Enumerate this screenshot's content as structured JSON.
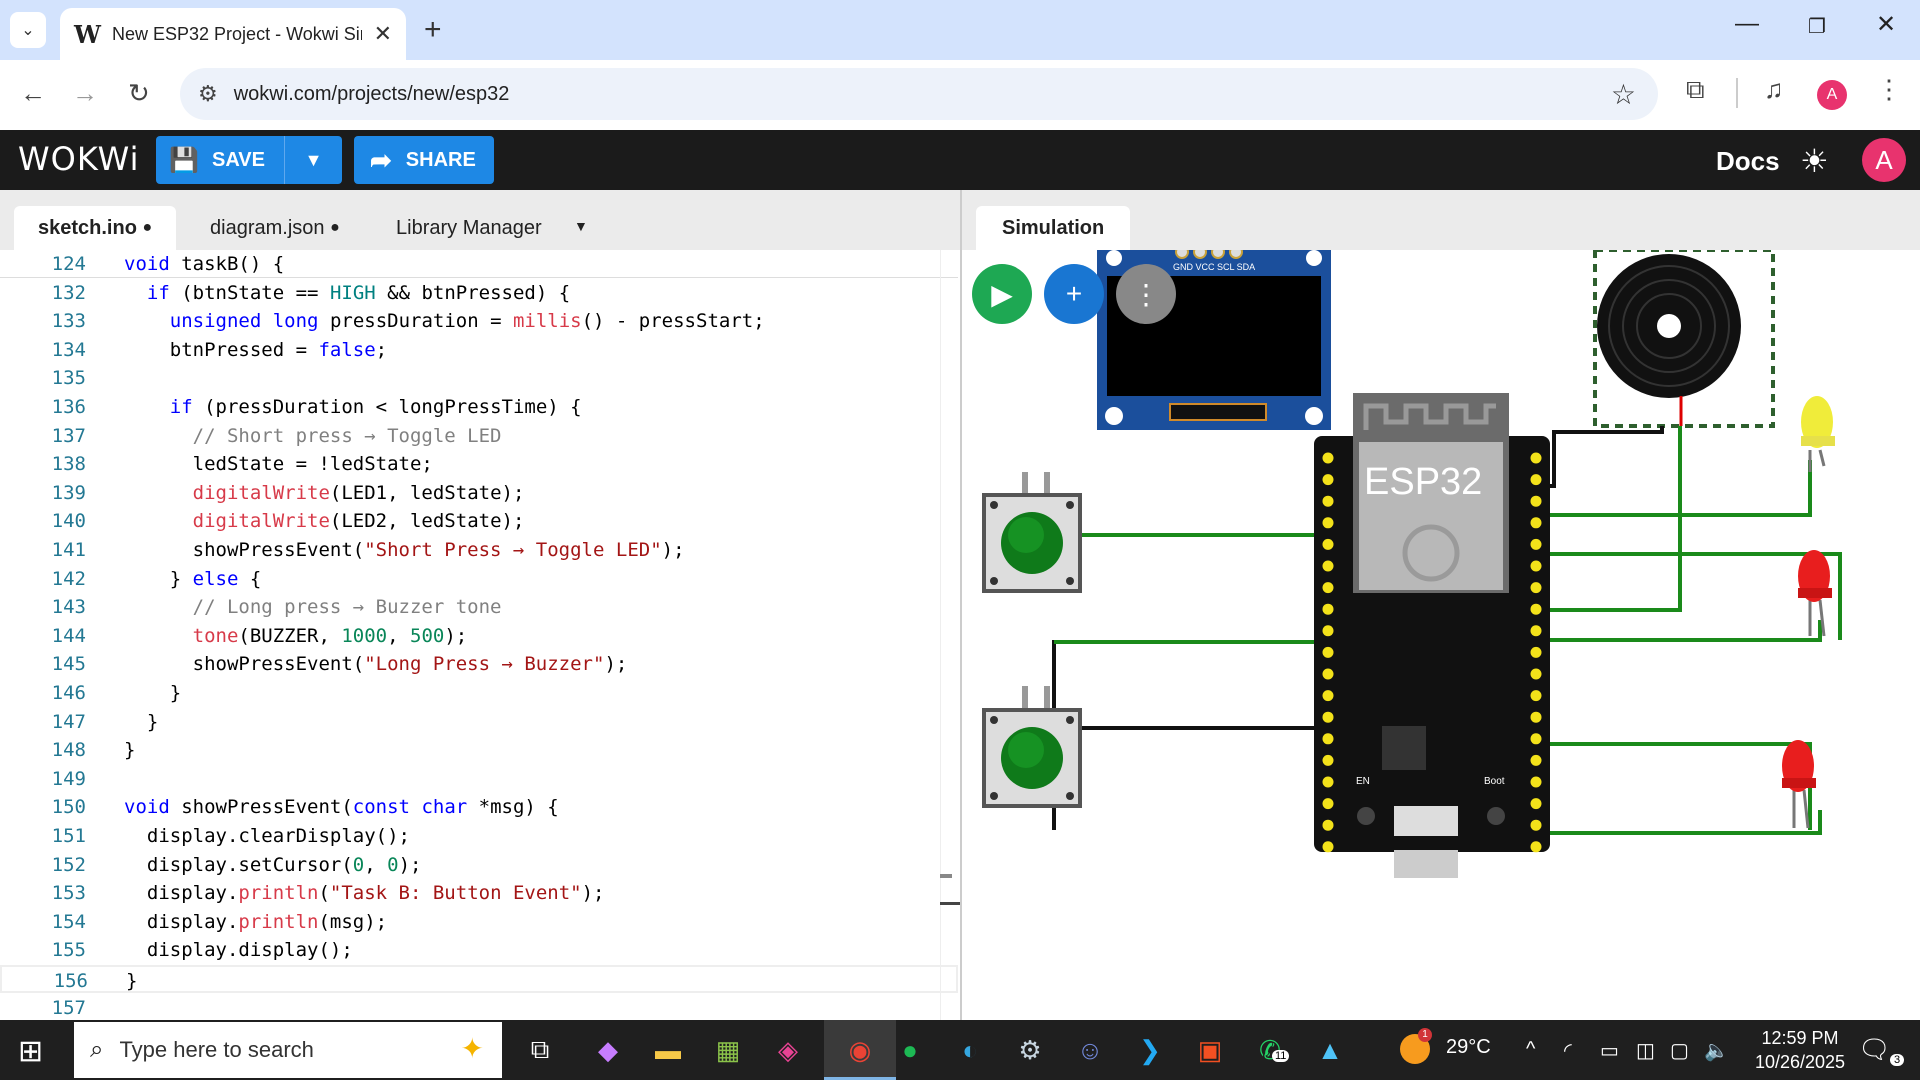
{
  "browser": {
    "tab_title": "New ESP32 Project - Wokwi Sim",
    "url": "wokwi.com/projects/new/esp32",
    "profile_initial": "A"
  },
  "header": {
    "logo": "WOKWi",
    "save_label": "SAVE",
    "share_label": "SHARE",
    "docs_label": "Docs",
    "user_initial": "A"
  },
  "editor": {
    "tabs": [
      {
        "label": "sketch.ino",
        "modified": "●"
      },
      {
        "label": "diagram.json",
        "modified": "●"
      },
      {
        "label": "Library Manager",
        "modified": ""
      }
    ],
    "lines": [
      {
        "n": "124",
        "t": "void taskB() {"
      },
      {
        "n": "132",
        "t": "  if (btnState == HIGH && btnPressed) {"
      },
      {
        "n": "133",
        "t": "    unsigned long pressDuration = millis() - pressStart;"
      },
      {
        "n": "134",
        "t": "    btnPressed = false;"
      },
      {
        "n": "135",
        "t": ""
      },
      {
        "n": "136",
        "t": "    if (pressDuration < longPressTime) {"
      },
      {
        "n": "137",
        "t": "      // Short press → Toggle LED"
      },
      {
        "n": "138",
        "t": "      ledState = !ledState;"
      },
      {
        "n": "139",
        "t": "      digitalWrite(LED1, ledState);"
      },
      {
        "n": "140",
        "t": "      digitalWrite(LED2, ledState);"
      },
      {
        "n": "141",
        "t": "      showPressEvent(\"Short Press → Toggle LED\");"
      },
      {
        "n": "142",
        "t": "    } else {"
      },
      {
        "n": "143",
        "t": "      // Long press → Buzzer tone"
      },
      {
        "n": "144",
        "t": "      tone(BUZZER, 1000, 500);"
      },
      {
        "n": "145",
        "t": "      showPressEvent(\"Long Press → Buzzer\");"
      },
      {
        "n": "146",
        "t": "    }"
      },
      {
        "n": "147",
        "t": "  }"
      },
      {
        "n": "148",
        "t": "}"
      },
      {
        "n": "149",
        "t": ""
      },
      {
        "n": "150",
        "t": "void showPressEvent(const char *msg) {"
      },
      {
        "n": "151",
        "t": "  display.clearDisplay();"
      },
      {
        "n": "152",
        "t": "  display.setCursor(0, 0);"
      },
      {
        "n": "153",
        "t": "  display.println(\"Task B: Button Event\");"
      },
      {
        "n": "154",
        "t": "  display.println(msg);"
      },
      {
        "n": "155",
        "t": "  display.display();"
      },
      {
        "n": "156",
        "t": "}"
      },
      {
        "n": "157",
        "t": ""
      }
    ]
  },
  "simulation": {
    "tab_label": "Simulation",
    "oled_pins": "GND VCC SCL SDA",
    "board_label": "ESP32",
    "en_label": "EN",
    "boot_label": "Boot"
  },
  "taskbar": {
    "search_placeholder": "Type here to search",
    "weather_temp": "29°C",
    "weather_badge": "1",
    "whatsapp_badge": "11",
    "time": "12:59 PM",
    "date": "10/26/2025",
    "notifications": "3"
  }
}
